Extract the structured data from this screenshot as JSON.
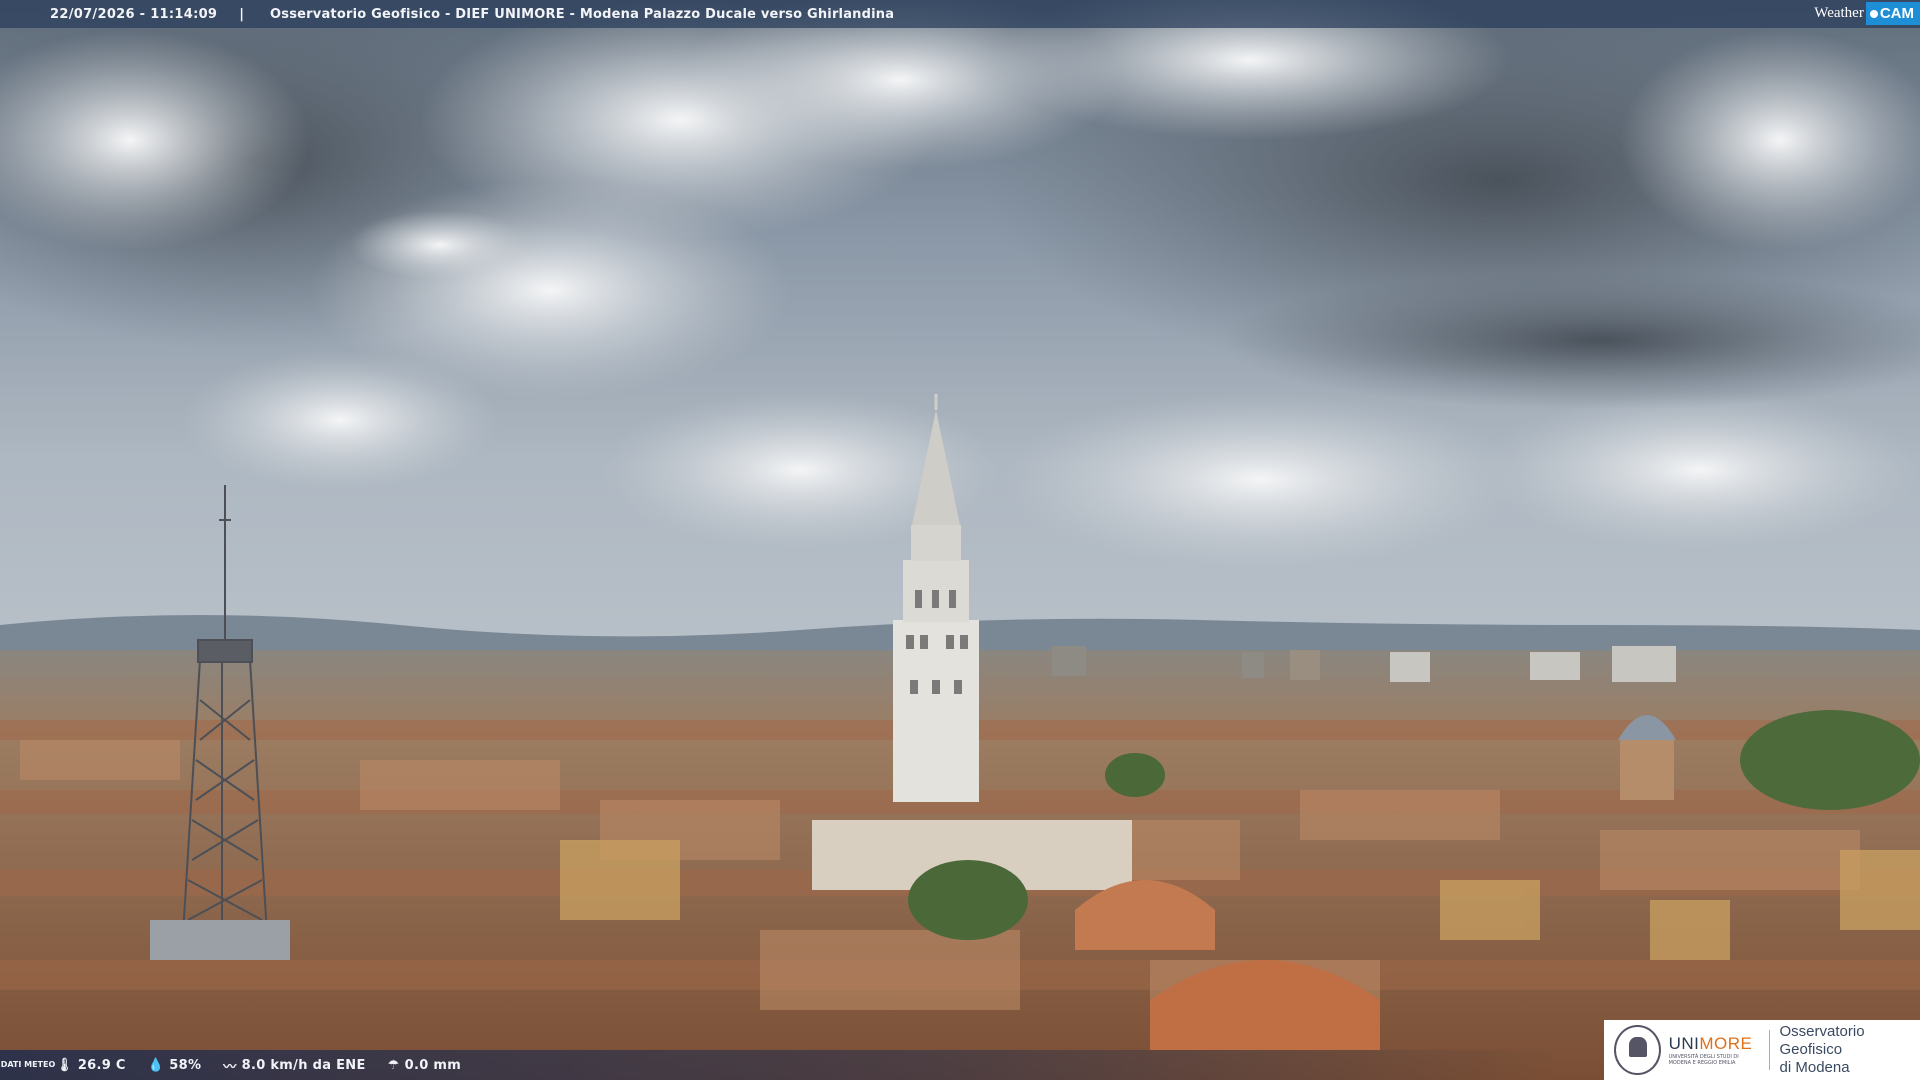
{
  "header": {
    "timestamp": "22/07/2026 - 11:14:09",
    "separator": "|",
    "title": "Osservatorio Geofisico - DIEF UNIMORE - Modena Palazzo Ducale verso Ghirlandina"
  },
  "brand": {
    "weather": "Weather",
    "cam": "CAM",
    "accent": "#1e8fd6"
  },
  "meteo": {
    "label": "DATI METEO",
    "temperature": "26.9 C",
    "humidity": "58%",
    "wind": "8.0 km/h da ENE",
    "rain": "0.0 mm",
    "icons": {
      "temperature": "thermometer-icon",
      "humidity": "droplet-icon",
      "wind": "wind-icon",
      "rain": "rain-icon"
    }
  },
  "logo": {
    "uni_prefix": "UNI",
    "uni_suffix": "MORE",
    "uni_sub": "UNIVERSITÀ DEGLI STUDI DI MODENA E REGGIO EMILIA",
    "observatory_line1": "Osservatorio Geofisico",
    "observatory_line2": "di Modena"
  }
}
